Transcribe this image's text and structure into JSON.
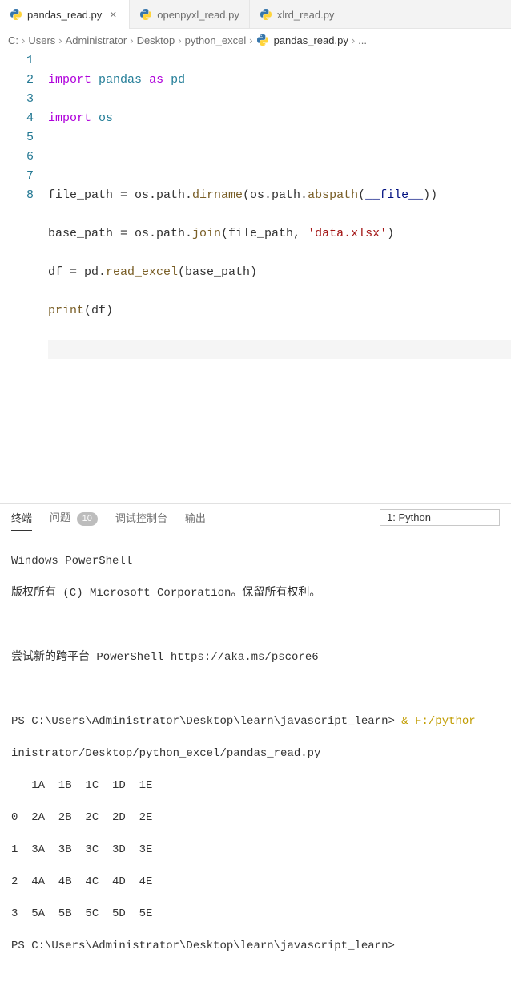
{
  "tabs": [
    {
      "label": "pandas_read.py",
      "active": true
    },
    {
      "label": "openpyxl_read.py",
      "active": false
    },
    {
      "label": "xlrd_read.py",
      "active": false
    }
  ],
  "breadcrumb": {
    "parts": [
      "C:",
      "Users",
      "Administrator",
      "Desktop",
      "python_excel"
    ],
    "current": "pandas_read.py",
    "sep": "›",
    "ellips": "..."
  },
  "code": {
    "lines": [
      "1",
      "2",
      "3",
      "4",
      "5",
      "6",
      "7",
      "8"
    ],
    "l1_import": "import",
    "l1_mod": "pandas",
    "l1_as": "as",
    "l1_alias": "pd",
    "l2_import": "import",
    "l2_mod": "os",
    "l4_a": "file_path = os.path.",
    "l4_dirname": "dirname",
    "l4_b": "(os.path.",
    "l4_abspath": "abspath",
    "l4_c": "(",
    "l4_file": "__file__",
    "l4_d": "))",
    "l5_a": "base_path = os.path.",
    "l5_join": "join",
    "l5_b": "(file_path, ",
    "l5_str": "'data.xlsx'",
    "l5_c": ")",
    "l6_a": "df = pd.",
    "l6_read": "read_excel",
    "l6_b": "(base_path)",
    "l7_print": "print",
    "l7_b": "(df)"
  },
  "panel": {
    "tabs": {
      "terminal": "终端",
      "problems": "问题",
      "debug": "调试控制台",
      "output": "输出",
      "badge": "10"
    },
    "dropdown": "1: Python"
  },
  "terminal": {
    "t1": "Windows PowerShell",
    "t2": "版权所有 (C) Microsoft Corporation。保留所有权利。",
    "t3": "尝试新的跨平台 PowerShell https://aka.ms/pscore6",
    "p1a": "PS C:\\Users\\Administrator\\Desktop\\learn\\javascript_learn> ",
    "p1b": "&",
    "p1c": " F:/pythor",
    "p1d": "inistrator/Desktop/python_excel/pandas_read.py",
    "o1": "   1A  1B  1C  1D  1E",
    "o2": "0  2A  2B  2C  2D  2E",
    "o3": "1  3A  3B  3C  3D  3E",
    "o4": "2  4A  4B  4C  4D  4E",
    "o5": "3  5A  5B  5C  5D  5E",
    "p2": "PS C:\\Users\\Administrator\\Desktop\\learn\\javascript_learn>"
  }
}
